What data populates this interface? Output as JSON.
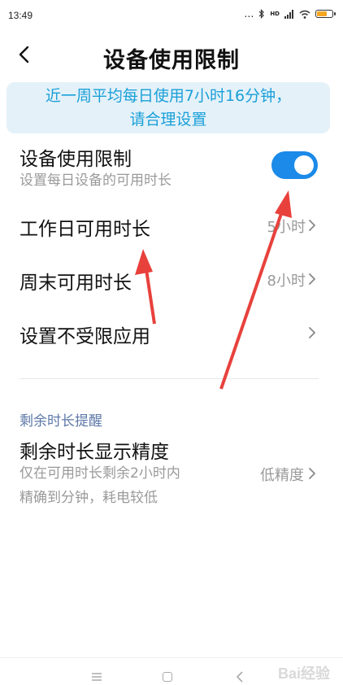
{
  "status_bar": {
    "time": "13:49",
    "indicators": "…",
    "network": "HD",
    "icons": [
      "bluetooth-icon",
      "signal-icon",
      "wifi-icon",
      "battery-icon"
    ]
  },
  "header": {
    "title": "设备使用限制",
    "back_icon": "chevron-left-icon"
  },
  "banner": {
    "line1": "近一周平均每日使用7小时16分钟，",
    "line2": "请合理设置"
  },
  "settings": {
    "limit_toggle": {
      "title": "设备使用限制",
      "subtitle": "设置每日设备的可用时长",
      "enabled": true
    },
    "workday": {
      "title": "工作日可用时长",
      "value": "5小时"
    },
    "weekend": {
      "title": "周末可用时长",
      "value": "8小时"
    },
    "unrestricted": {
      "title": "设置不受限应用"
    }
  },
  "reminder_section": {
    "header": "剩余时长提醒",
    "precision": {
      "title": "剩余时长显示精度",
      "subtitle_line1": "仅在可用时长剩余2小时内",
      "subtitle_line2": "精确到分钟，耗电较低",
      "value": "低精度"
    }
  },
  "nav_bar": {
    "icons": [
      "menu-icon",
      "home-icon",
      "back-icon"
    ]
  },
  "watermark": "Bai经验",
  "colors": {
    "accent": "#1b8ae8",
    "banner_bg": "#e4f1f9",
    "banner_text": "#1aa0d8",
    "section_header": "#5d78a8",
    "annotation_arrow": "#e8413c"
  }
}
